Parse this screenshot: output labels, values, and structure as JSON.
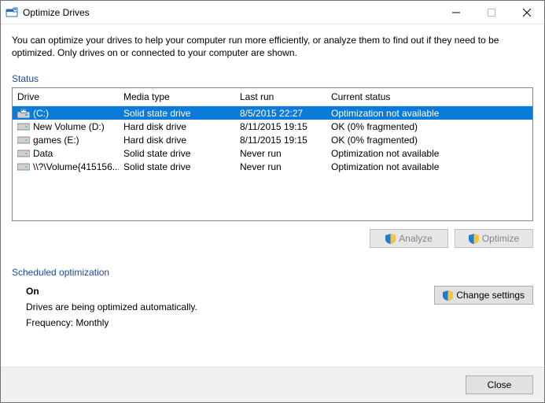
{
  "window": {
    "title": "Optimize Drives"
  },
  "intro": "You can optimize your drives to help your computer run more efficiently, or analyze them to find out if they need to be optimized. Only drives on or connected to your computer are shown.",
  "status_label": "Status",
  "columns": {
    "drive": "Drive",
    "media": "Media type",
    "last": "Last run",
    "status": "Current status"
  },
  "rows": [
    {
      "drive": "(C:)",
      "media": "Solid state drive",
      "last": "8/5/2015 22:27",
      "status": "Optimization not available",
      "selected": true,
      "icon": "os"
    },
    {
      "drive": "New Volume (D:)",
      "media": "Hard disk drive",
      "last": "8/11/2015 19:15",
      "status": "OK (0% fragmented)",
      "selected": false,
      "icon": "hdd"
    },
    {
      "drive": "games (E:)",
      "media": "Hard disk drive",
      "last": "8/11/2015 19:15",
      "status": "OK (0% fragmented)",
      "selected": false,
      "icon": "hdd"
    },
    {
      "drive": "Data",
      "media": "Solid state drive",
      "last": "Never run",
      "status": "Optimization not available",
      "selected": false,
      "icon": "hdd"
    },
    {
      "drive": "\\\\?\\Volume{415156...",
      "media": "Solid state drive",
      "last": "Never run",
      "status": "Optimization not available",
      "selected": false,
      "icon": "hdd"
    }
  ],
  "buttons": {
    "analyze": "Analyze",
    "optimize": "Optimize",
    "change_settings": "Change settings",
    "close": "Close"
  },
  "scheduled": {
    "label": "Scheduled optimization",
    "state": "On",
    "line1": "Drives are being optimized automatically.",
    "line2": "Frequency: Monthly"
  }
}
